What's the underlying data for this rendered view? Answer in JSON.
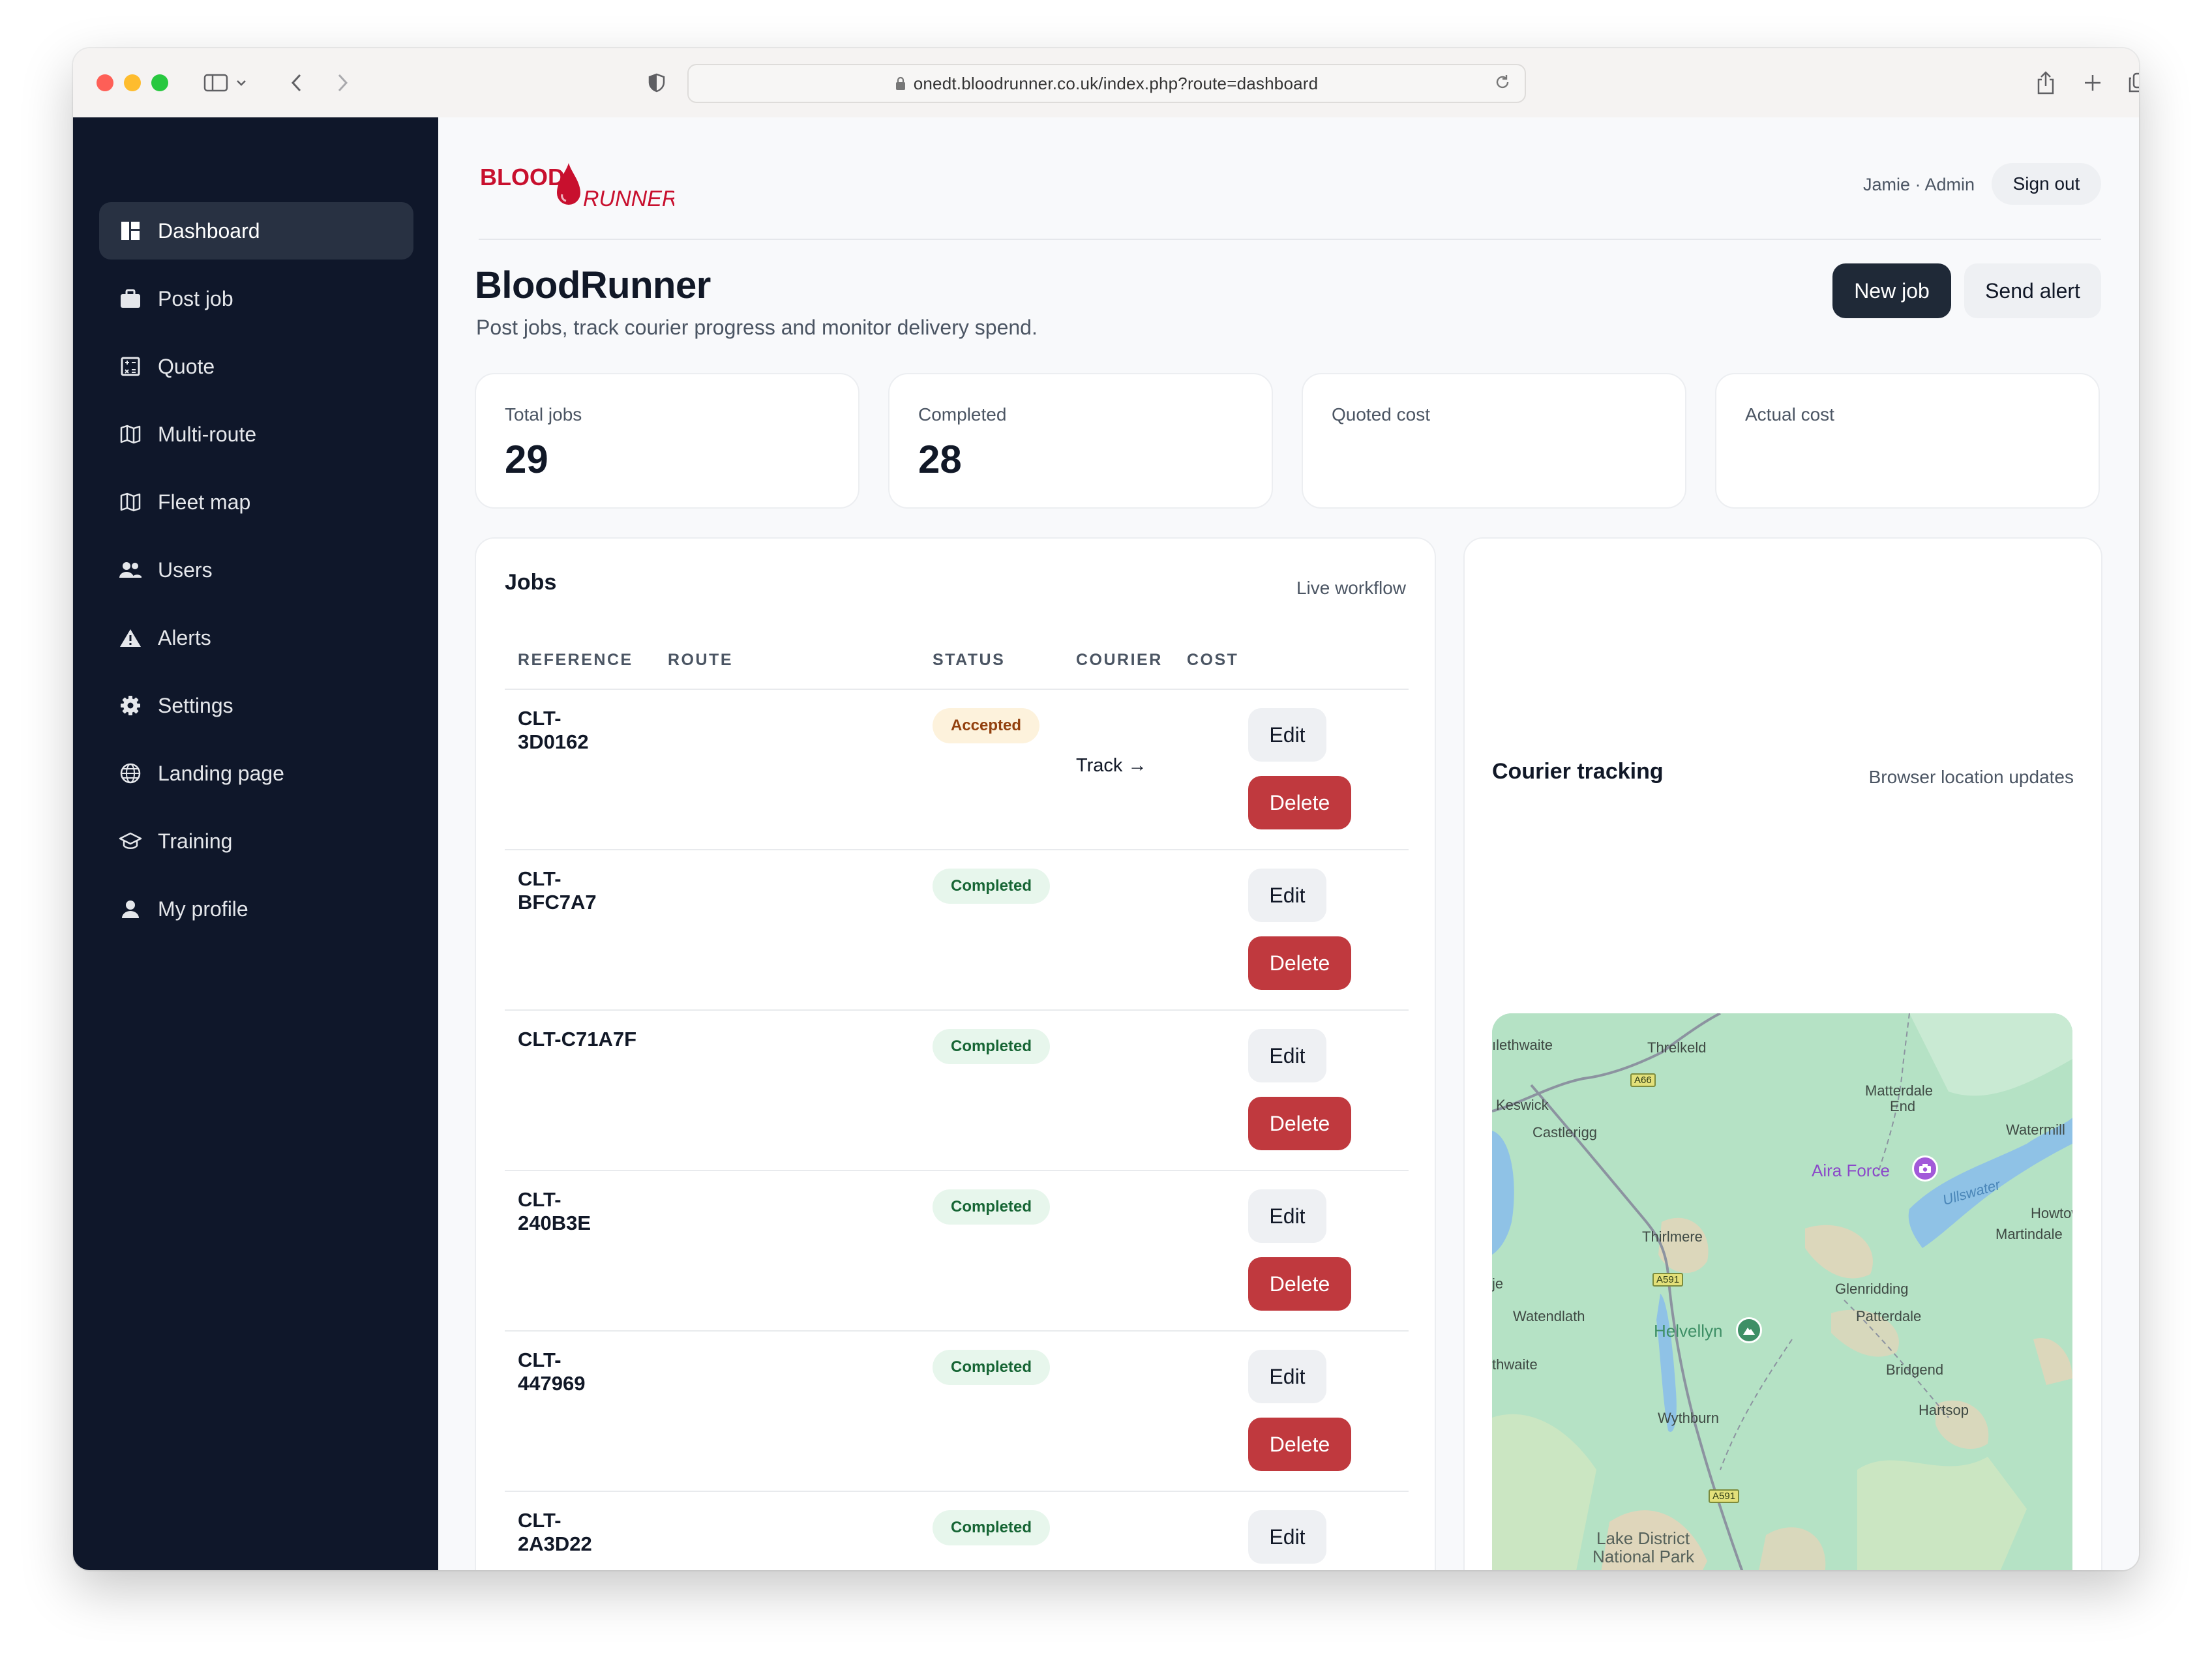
{
  "browser": {
    "url": "onedt.bloodrunner.co.uk/index.php?route=dashboard"
  },
  "sidebar": {
    "items": [
      {
        "label": "Dashboard",
        "icon": "dashboard-icon",
        "active": true
      },
      {
        "label": "Post job",
        "icon": "briefcase-icon"
      },
      {
        "label": "Quote",
        "icon": "calculator-icon"
      },
      {
        "label": "Multi-route",
        "icon": "map-icon"
      },
      {
        "label": "Fleet map",
        "icon": "map-icon"
      },
      {
        "label": "Users",
        "icon": "users-icon"
      },
      {
        "label": "Alerts",
        "icon": "warning-icon"
      },
      {
        "label": "Settings",
        "icon": "gear-icon"
      },
      {
        "label": "Landing page",
        "icon": "globe-icon"
      },
      {
        "label": "Training",
        "icon": "graduation-cap-icon"
      },
      {
        "label": "My profile",
        "icon": "user-icon"
      }
    ]
  },
  "header": {
    "logo_text_1": "BLOOD",
    "logo_text_2": "RUNNER",
    "user": "Jamie · Admin",
    "sign_out": "Sign out"
  },
  "page": {
    "title": "BloodRunner",
    "subtitle": "Post jobs, track courier progress and monitor delivery spend.",
    "new_job": "New job",
    "send_alert": "Send alert"
  },
  "stats": [
    {
      "label": "Total jobs",
      "value": "29"
    },
    {
      "label": "Completed",
      "value": "28"
    },
    {
      "label": "Quoted cost",
      "value": ""
    },
    {
      "label": "Actual cost",
      "value": ""
    }
  ],
  "jobs": {
    "title": "Jobs",
    "meta": "Live workflow",
    "columns": [
      "REFERENCE",
      "ROUTE",
      "STATUS",
      "COURIER",
      "COST"
    ],
    "edit_label": "Edit",
    "delete_label": "Delete",
    "rows": [
      {
        "ref_line1": "CLT-",
        "ref_line2": "3D0162",
        "status": "Accepted",
        "courier": "Track →"
      },
      {
        "ref_line1": "CLT-",
        "ref_line2": "BFC7A7",
        "status": "Completed",
        "courier": ""
      },
      {
        "ref_line1": "CLT-C71A7F",
        "ref_line2": "",
        "status": "Completed",
        "courier": ""
      },
      {
        "ref_line1": "CLT-",
        "ref_line2": "240B3E",
        "status": "Completed",
        "courier": ""
      },
      {
        "ref_line1": "CLT-",
        "ref_line2": "447969",
        "status": "Completed",
        "courier": ""
      },
      {
        "ref_line1": "CLT-",
        "ref_line2": "2A3D22",
        "status": "Completed",
        "courier": ""
      }
    ]
  },
  "tracking": {
    "title": "Courier tracking",
    "meta": "Browser location updates",
    "map_labels": {
      "l1": "ılethwaite",
      "l2": "Threlkeld",
      "l3": "Keswick",
      "l4": "Castlerigg",
      "l5": "Matterdale",
      "l5b": "End",
      "l6": "Watermill",
      "l7": "Aira Force",
      "l8": "Ullswater",
      "l9": "Howtowr",
      "l10": "Martindale",
      "l11": "Thirlmere",
      "l12": "Glenridding",
      "l13": "Patterdale",
      "l14": "Watendlath",
      "l15": "Helvellyn",
      "l16": "thwaite",
      "l17": "Bridgend",
      "l18": "Hartsop",
      "l19": "Wythburn",
      "l20": "Lake District",
      "l21": "National Park",
      "l22": "je",
      "r1": "A66",
      "r2": "A591",
      "r3": "A591"
    }
  }
}
